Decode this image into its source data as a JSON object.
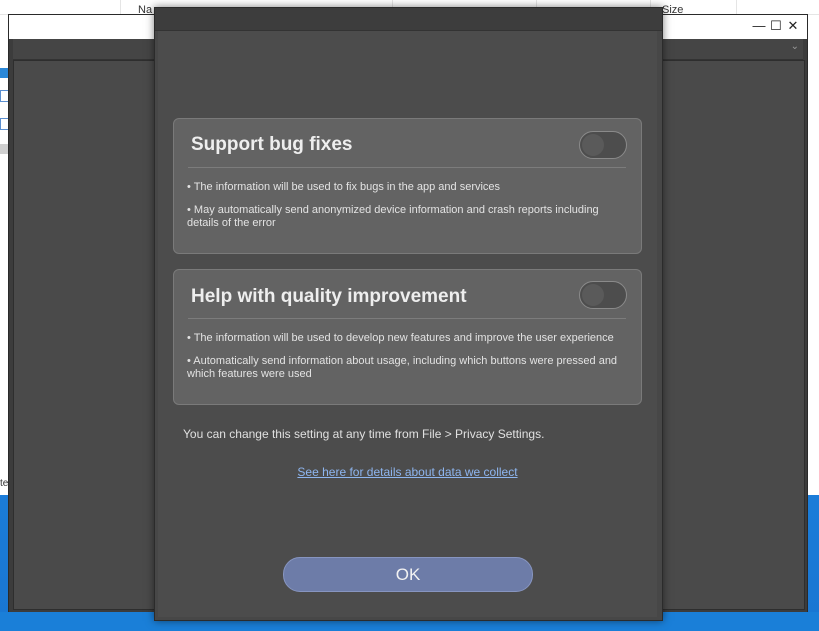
{
  "explorer": {
    "col_name": "Na",
    "col_size": "Size",
    "edge_text": "te",
    "sort_icon": "chevron-up-icon"
  },
  "back_window": {
    "minimize": "—",
    "maximize": "☐",
    "close": "✕",
    "toolbar_chevron": "⌄"
  },
  "dialog": {
    "cards": [
      {
        "title": "Support bug fixes",
        "toggle_on": false,
        "bullets": [
          "• The information will be used to fix bugs in the app and services",
          "• May automatically send anonymized device information and crash reports including details of the error"
        ]
      },
      {
        "title": "Help with quality improvement",
        "toggle_on": false,
        "bullets": [
          "• The information will be used to develop new features and improve the user experience",
          "• Automatically send information about usage, including which buttons were pressed and which features were used"
        ]
      }
    ],
    "note": "You can change this setting at any time from File > Privacy Settings.",
    "link": "See here for details about data we collect",
    "ok_label": "OK"
  },
  "colors": {
    "dialog_bg": "#4c4c4c",
    "card_bg": "#636363",
    "ok_button": "#6d7ca8",
    "link": "#8eb6f0"
  }
}
